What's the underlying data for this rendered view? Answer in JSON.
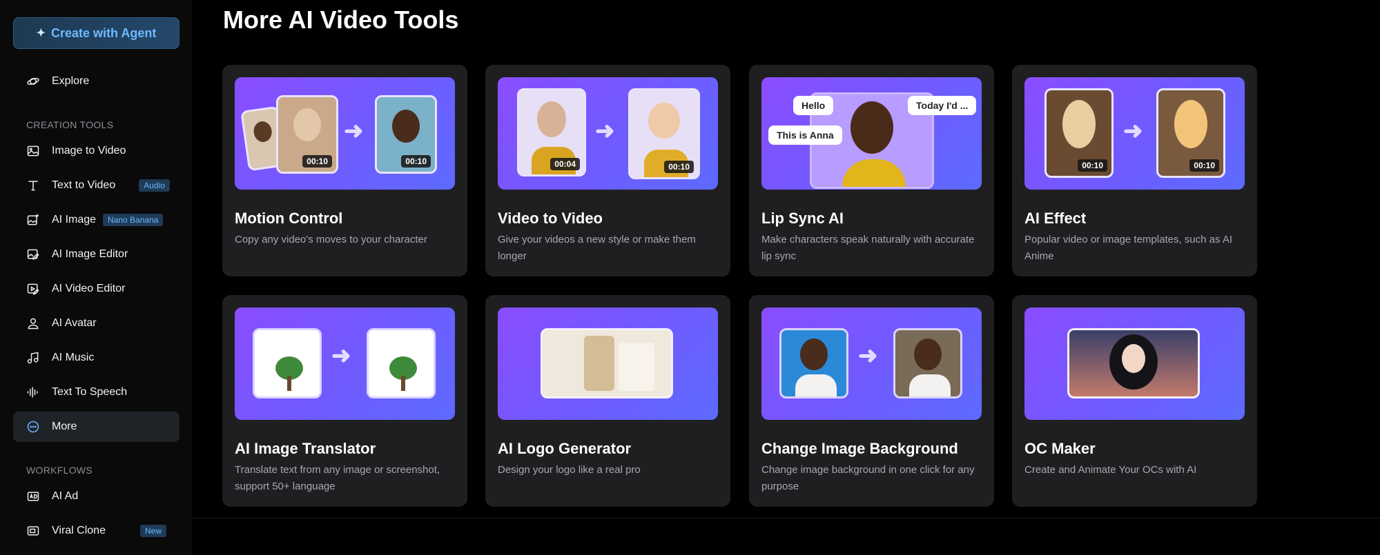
{
  "sidebar": {
    "agent_button": "Create with Agent",
    "explore": "Explore",
    "creation_tools_label": "CREATION TOOLS",
    "items": [
      {
        "label": "Image to Video",
        "badge": ""
      },
      {
        "label": "Text to Video",
        "badge": "Audio"
      },
      {
        "label": "AI Image",
        "badge": "Nano Banana"
      },
      {
        "label": "AI Image Editor",
        "badge": ""
      },
      {
        "label": "AI Video Editor",
        "badge": ""
      },
      {
        "label": "AI Avatar",
        "badge": ""
      },
      {
        "label": "AI Music",
        "badge": ""
      },
      {
        "label": "Text To Speech",
        "badge": ""
      },
      {
        "label": "More",
        "badge": ""
      }
    ],
    "workflows_label": "WORKFLOWS",
    "workflows": [
      {
        "label": "AI Ad",
        "badge": ""
      },
      {
        "label": "Viral Clone",
        "badge": "New"
      }
    ]
  },
  "main": {
    "title": "More AI Video Tools",
    "cards": [
      {
        "title": "Motion Control",
        "desc": "Copy any video's moves to your character",
        "d1": "00:10",
        "d2": "00:10"
      },
      {
        "title": "Video to Video",
        "desc": "Give your videos a new style or make them longer",
        "d1": "00:04",
        "d2": "00:10"
      },
      {
        "title": "Lip Sync AI",
        "desc": "Make characters speak naturally with accurate lip sync",
        "b1": "Hello",
        "b2": "Today I'd ...",
        "b3": "This is Anna"
      },
      {
        "title": "AI Effect",
        "desc": "Popular video or image templates, such as AI Anime",
        "d1": "00:10",
        "d2": "00:10"
      },
      {
        "title": "AI Image Translator",
        "desc": "Translate text from any image or screenshot, support 50+ language"
      },
      {
        "title": "AI Logo Generator",
        "desc": "Design your logo like a real pro"
      },
      {
        "title": "Change Image Background",
        "desc": "Change image background in one click for any purpose"
      },
      {
        "title": "OC Maker",
        "desc": "Create and Animate Your OCs with AI"
      }
    ]
  },
  "colors": {
    "accent": "#6bb6ff",
    "card_bg": "#1f1f22",
    "thumb_start": "#8a4dff",
    "thumb_end": "#5d6bff"
  }
}
